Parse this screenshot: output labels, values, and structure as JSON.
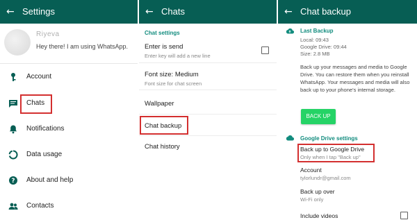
{
  "settings": {
    "title": "Settings",
    "profile": {
      "name": "Riyeva",
      "status": "Hey there! I am using WhatsApp."
    },
    "items": [
      {
        "label": "Account",
        "icon": "key-icon"
      },
      {
        "label": "Chats",
        "icon": "chat-icon"
      },
      {
        "label": "Notifications",
        "icon": "bell-icon"
      },
      {
        "label": "Data usage",
        "icon": "data-usage-icon"
      },
      {
        "label": "About and help",
        "icon": "help-icon"
      },
      {
        "label": "Contacts",
        "icon": "contacts-icon"
      }
    ]
  },
  "chats": {
    "title": "Chats",
    "section": "Chat settings",
    "enter_is_send": {
      "title": "Enter is send",
      "subtitle": "Enter key will add a new line",
      "checked": false
    },
    "font_size": {
      "title": "Font size: Medium",
      "subtitle": "Font size for chat screen"
    },
    "wallpaper": "Wallpaper",
    "chat_backup": "Chat backup",
    "chat_history": "Chat history"
  },
  "backup": {
    "title": "Chat backup",
    "last_backup_section": "Last Backup",
    "local": "Local: 09:43",
    "drive": "Google Drive: 09:44",
    "size": "Size: 2.8 MB",
    "description": "Back up your messages and media to Google Drive. You can restore them when you reinstall WhatsApp. Your messages and media will also back up to your phone's internal storage.",
    "button": "BACK UP",
    "drive_section": "Google Drive settings",
    "backup_to_drive": {
      "title": "Back up to Google Drive",
      "subtitle": "Only when I tap \"Back up\""
    },
    "account": {
      "title": "Account",
      "value": "tylorlundr@gmail.com"
    },
    "backup_over": {
      "title": "Back up over",
      "value": "Wi-Fi only"
    },
    "include_videos": {
      "title": "Include videos",
      "checked": false
    }
  },
  "colors": {
    "appbar": "#075e54",
    "accent": "#128c7e",
    "button": "#25d366",
    "highlight": "#d32f2f"
  }
}
